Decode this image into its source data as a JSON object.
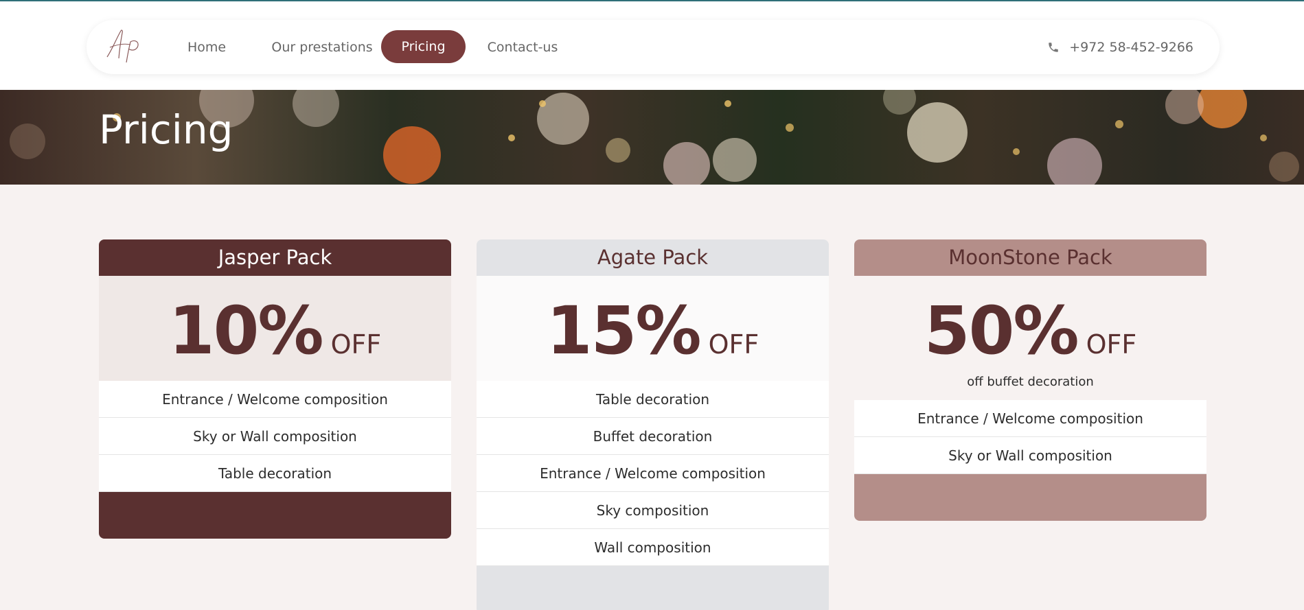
{
  "nav": {
    "logo_text": "Ap",
    "links": [
      {
        "label": "Home"
      },
      {
        "label": "Our prestations"
      },
      {
        "label": "Pricing",
        "active": true
      },
      {
        "label": "Contact-us"
      }
    ],
    "phone_icon": "phone-icon",
    "phone": "+972 58-452-9266"
  },
  "hero": {
    "title": "Pricing"
  },
  "packs": [
    {
      "name": "Jasper Pack",
      "percent": "10%",
      "off": "OFF",
      "items": [
        "Entrance / Welcome composition",
        "Sky or Wall composition",
        "Table decoration"
      ]
    },
    {
      "name": "Agate Pack",
      "percent": "15%",
      "off": "OFF",
      "items": [
        "Table decoration",
        "Buffet decoration",
        "Entrance / Welcome composition",
        "Sky composition",
        "Wall composition"
      ]
    },
    {
      "name": "MoonStone Pack",
      "percent": "50%",
      "off": "OFF",
      "note": "off buffet decoration",
      "items": [
        "Entrance / Welcome composition",
        "Sky or Wall composition"
      ]
    }
  ],
  "colors": {
    "brand": "#7a3c3c",
    "dark_brand": "#5a3030",
    "accent_rose": "#b48e89",
    "page_bg": "#f7f2f1"
  }
}
